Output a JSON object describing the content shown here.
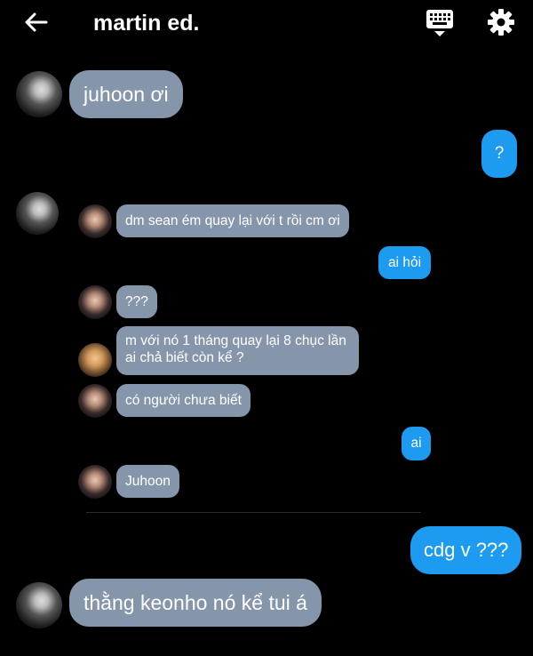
{
  "header": {
    "title": "martin ed.",
    "back_icon": "arrow-left-icon",
    "keyboard_icon": "keyboard-icon",
    "settings_icon": "gear-icon"
  },
  "messages": [
    {
      "side": "left",
      "text": "juhoon ơi"
    },
    {
      "side": "right",
      "text": "?"
    },
    {
      "side": "left-quote",
      "text": "dm sean ém quay lại với t rồi cm ơi"
    },
    {
      "side": "right",
      "text": "ai hỏi"
    },
    {
      "side": "left-quote",
      "text": "???"
    },
    {
      "side": "left-quote",
      "lines": [
        "m với nó 1 tháng quay lại 8 chục lần",
        "ai  chả biết còn kể ?"
      ]
    },
    {
      "side": "left-quote",
      "text": "có người chưa biết"
    },
    {
      "side": "right",
      "text": "ai"
    },
    {
      "side": "left-quote",
      "text": "Juhoon"
    },
    {
      "side": "right",
      "text": "cdg v ???"
    },
    {
      "side": "left",
      "text": "thằng keonho nó kể tui á"
    }
  ],
  "colors": {
    "background": "#000000",
    "incoming_bubble": "#8596ab",
    "outgoing_bubble": "#1d9bf0"
  }
}
